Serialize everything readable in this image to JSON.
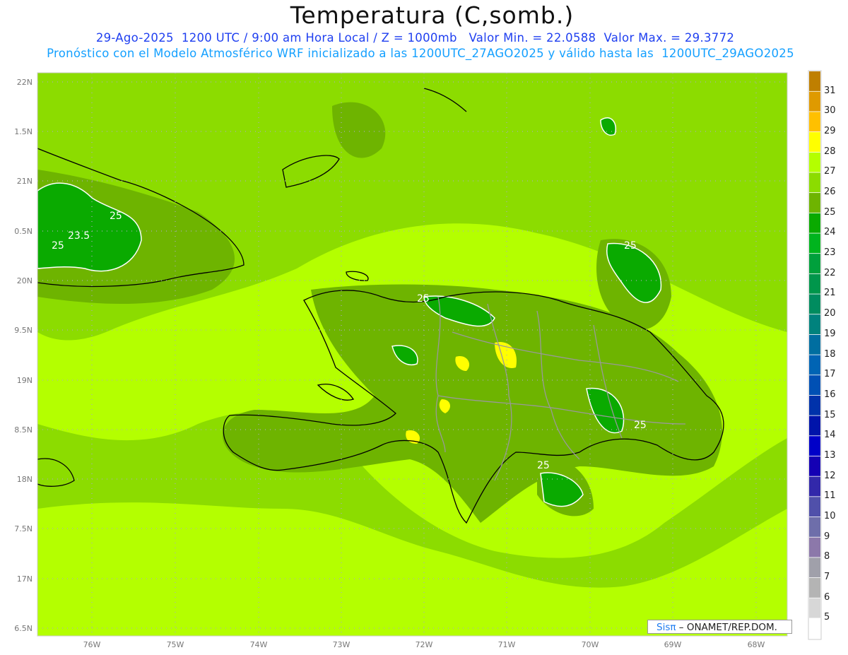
{
  "title": "Temperatura (C,somb.)",
  "subtitle_line1": "29-Ago-2025  1200 UTC / 9:00 am Hora Local / Z = 1000mb   Valor Min. = 22.0588  Valor Max. = 29.3772",
  "subtitle_line2": "Pronóstico con el Modelo Atmosférico WRF inicializado a las 1200UTC_27AGO2025 y válido hasta las  1200UTC_29AGO2025",
  "map": {
    "lon_labels": [
      "76W",
      "75W",
      "74W",
      "73W",
      "72W",
      "71W",
      "70W",
      "69W",
      "68W"
    ],
    "lat_labels": [
      "22N",
      "1.5N",
      "21N",
      "0.5N",
      "20N",
      "9.5N",
      "19N",
      "8.5N",
      "18N",
      "7.5N",
      "17N",
      "6.5N"
    ],
    "contour_labels": [
      "25",
      "23.5",
      "25",
      "25",
      "25",
      "25",
      "25"
    ],
    "min_value": 22.0588,
    "max_value": 29.3772
  },
  "colorbar": {
    "labels": [
      "31",
      "30",
      "29",
      "28",
      "27",
      "26",
      "25",
      "24",
      "23",
      "22",
      "21",
      "20",
      "19",
      "18",
      "17",
      "16",
      "15",
      "14",
      "13",
      "12",
      "11",
      "10",
      "9",
      "8",
      "7",
      "6",
      "5"
    ],
    "colors": [
      "#bf7f00",
      "#df9a00",
      "#ffc000",
      "#ffff00",
      "#b4ff00",
      "#8cdc00",
      "#6eb400",
      "#0aaa00",
      "#00b41e",
      "#00a03c",
      "#00964b",
      "#008c5f",
      "#00827d",
      "#006ea0",
      "#0064b4",
      "#0050b4",
      "#0032aa",
      "#0014aa",
      "#0000c8",
      "#1400b4",
      "#3228aa",
      "#5050aa",
      "#6e6eaa",
      "#8c78aa",
      "#a0a0aa",
      "#b4b4b4",
      "#d7d7d7",
      "#ffffff"
    ]
  },
  "credit": {
    "brand": "Sisπ",
    "text": "– ONAMET/REP.DOM."
  }
}
